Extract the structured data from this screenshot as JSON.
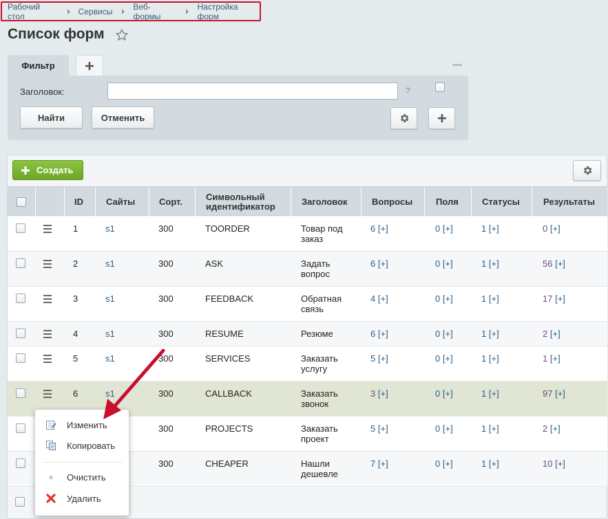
{
  "breadcrumb": [
    "Рабочий стол",
    "Сервисы",
    "Веб-формы",
    "Настройка форм"
  ],
  "page_title": "Список форм",
  "filter": {
    "tab_label": "Фильтр",
    "title_label": "Заголовок:",
    "title_value": "",
    "help": "?",
    "find_label": "Найти",
    "cancel_label": "Отменить"
  },
  "toolbar": {
    "create_label": "Создать"
  },
  "columns": [
    "ID",
    "Сайты",
    "Сорт.",
    "Символьный идентификатор",
    "Заголовок",
    "Вопросы",
    "Поля",
    "Статусы",
    "Результаты"
  ],
  "rows": [
    {
      "id": "1",
      "site": "s1",
      "sort": "300",
      "code": "TOORDER",
      "title": "Товар под заказ",
      "questions": "6",
      "fields": "0",
      "statuses": "1",
      "results": "0"
    },
    {
      "id": "2",
      "site": "s1",
      "sort": "300",
      "code": "ASK",
      "title": "Задать вопрос",
      "questions": "6",
      "fields": "0",
      "statuses": "1",
      "results": "56"
    },
    {
      "id": "3",
      "site": "s1",
      "sort": "300",
      "code": "FEEDBACK",
      "title": "Обратная связь",
      "questions": "4",
      "fields": "0",
      "statuses": "1",
      "results": "17"
    },
    {
      "id": "4",
      "site": "s1",
      "sort": "300",
      "code": "RESUME",
      "title": "Резюме",
      "questions": "6",
      "fields": "0",
      "statuses": "1",
      "results": "2"
    },
    {
      "id": "5",
      "site": "s1",
      "sort": "300",
      "code": "SERVICES",
      "title": "Заказать услугу",
      "questions": "5",
      "fields": "0",
      "statuses": "1",
      "results": "1"
    },
    {
      "id": "6",
      "site": "s1",
      "sort": "300",
      "code": "CALLBACK",
      "title": "Заказать звонок",
      "questions": "3",
      "fields": "0",
      "statuses": "1",
      "results": "97"
    },
    {
      "id": "",
      "site": "",
      "sort": "300",
      "code": "PROJECTS",
      "title": "Заказать проект",
      "questions": "5",
      "fields": "0",
      "statuses": "1",
      "results": "2"
    },
    {
      "id": "",
      "site": "",
      "sort": "300",
      "code": "CHEAPER",
      "title": "Нашли дешевле",
      "questions": "7",
      "fields": "0",
      "statuses": "1",
      "results": "10"
    }
  ],
  "add_suffix": "[+]",
  "context_menu": {
    "edit": "Изменить",
    "copy": "Копировать",
    "clear": "Очистить",
    "delete": "Удалить"
  },
  "colors": {
    "annotation": "#c8102e",
    "create_button": "#7ab536",
    "highlight_row": "#e1e5d4"
  }
}
